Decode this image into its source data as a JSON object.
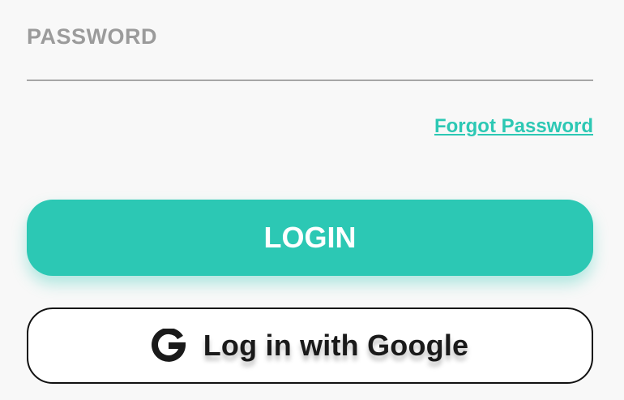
{
  "password": {
    "label": "PASSWORD",
    "value": ""
  },
  "forgot_password": {
    "label": "Forgot Password"
  },
  "login_button": {
    "label": "LOGIN"
  },
  "google_button": {
    "label": "Log in with Google",
    "icon": "google-icon"
  },
  "colors": {
    "accent": "#2cc8b4",
    "label_gray": "#9b9b9b",
    "background": "#f8f8f8"
  }
}
